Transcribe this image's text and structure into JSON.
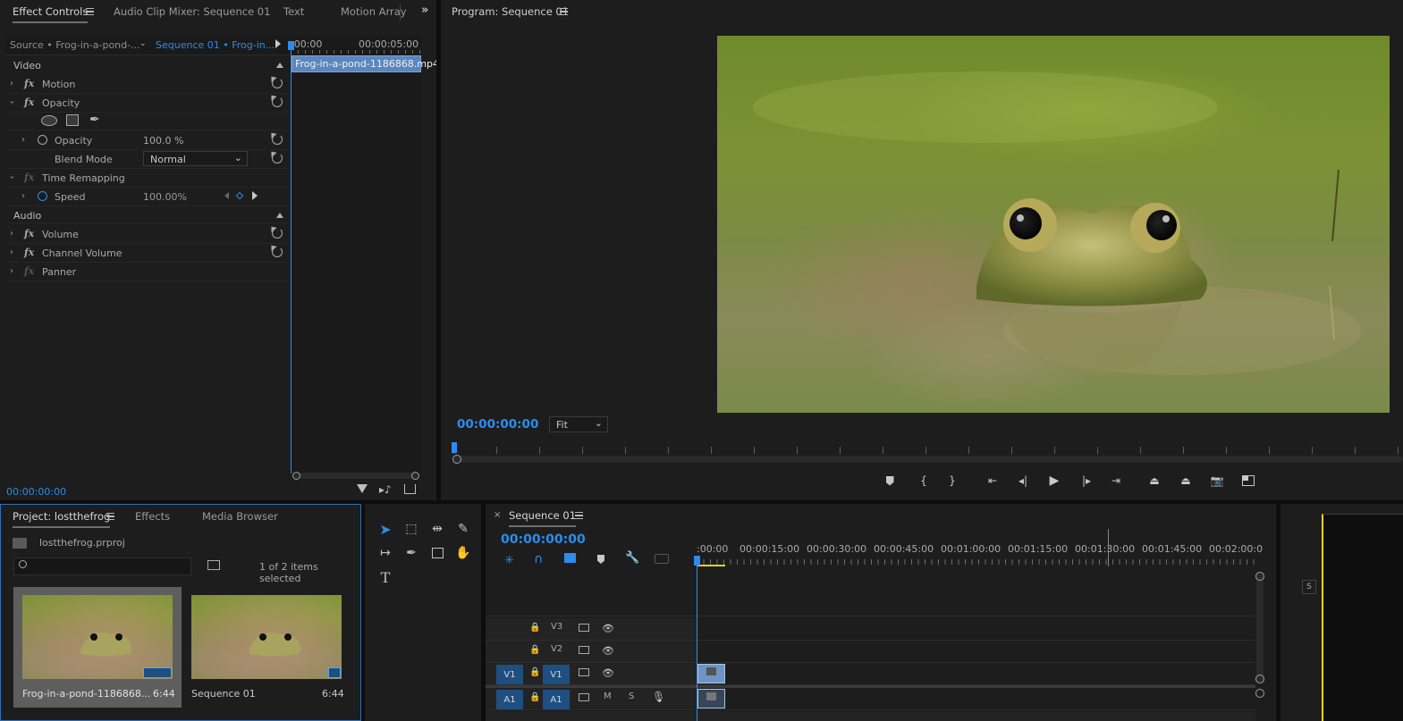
{
  "effect_controls": {
    "tabs": [
      {
        "label": "Effect Controls"
      },
      {
        "label": "Audio Clip Mixer: Sequence 01"
      },
      {
        "label": "Text"
      },
      {
        "label": "Motion Array"
      }
    ],
    "source_label": "Source • Frog-in-a-pond-...",
    "sequence_label": "Sequence 01 • Frog-in...",
    "ruler_start": ":00:00",
    "ruler_mid": "00:00:05:00",
    "clip_name": "Frog-in-a-pond-1186868.mp4",
    "video_header": "Video",
    "audio_header": "Audio",
    "rows": {
      "motion": "Motion",
      "opacity_group": "Opacity",
      "opacity": "Opacity",
      "opacity_value": "100.0 %",
      "blend_mode": "Blend Mode",
      "blend_value": "Normal",
      "time_remapping": "Time Remapping",
      "speed": "Speed",
      "speed_value": "100.00%",
      "volume": "Volume",
      "channel_volume": "Channel Volume",
      "panner": "Panner"
    },
    "timecode": "00:00:00:00"
  },
  "program": {
    "title": "Program: Sequence 01",
    "timecode": "00:00:00:00",
    "fit": "Fit"
  },
  "project": {
    "tabs": [
      {
        "label": "Project: lostthefrog"
      },
      {
        "label": "Effects"
      },
      {
        "label": "Media Browser"
      }
    ],
    "file": "lostthefrog.prproj",
    "selection": "1 of 2 items selected",
    "items": [
      {
        "name": "Frog-in-a-pond-1186868...",
        "duration": "6:44"
      },
      {
        "name": "Sequence 01",
        "duration": "6:44"
      }
    ]
  },
  "timeline": {
    "tab": "Sequence 01",
    "timecode": "00:00:00:00",
    "ruler": [
      ":00:00",
      "00:00:15:00",
      "00:00:30:00",
      "00:00:45:00",
      "00:01:00:00",
      "00:01:15:00",
      "00:01:30:00",
      "00:01:45:00",
      "00:02:00:0"
    ],
    "tracks": [
      {
        "name": "V3"
      },
      {
        "name": "V2"
      },
      {
        "name": "V1",
        "source": "V1"
      },
      {
        "name": "A1",
        "source": "A1"
      }
    ],
    "m_label": "M",
    "s_label": "S"
  },
  "audio_meter": {
    "s_label": "S"
  },
  "colors": {
    "accent": "#2d8ceb",
    "patch": "#1f4f80",
    "playhead_yellow": "#e6d21a"
  }
}
